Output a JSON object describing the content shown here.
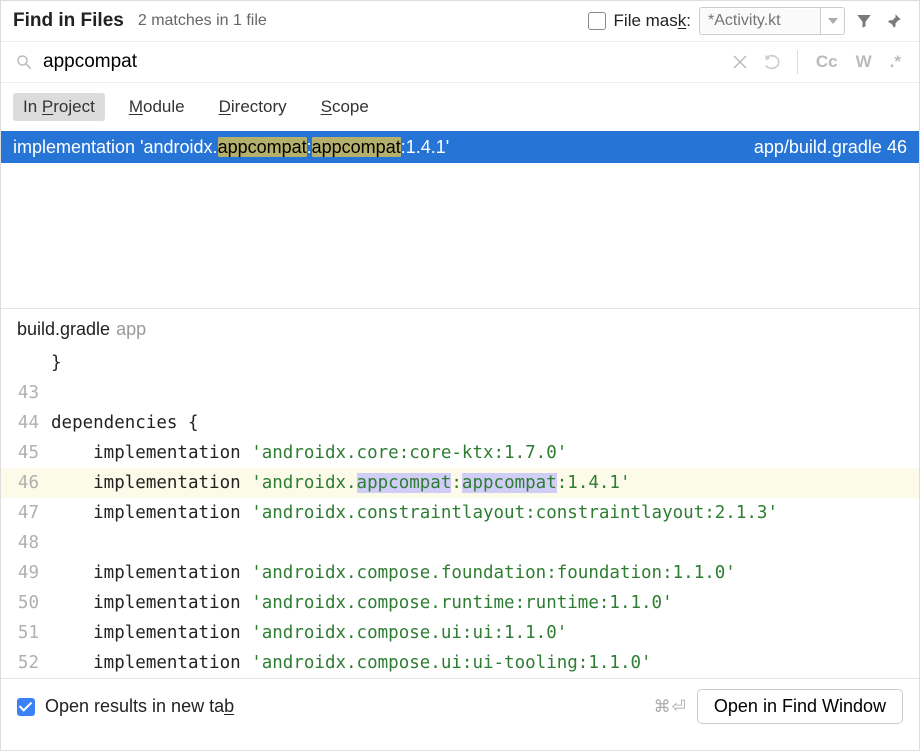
{
  "header": {
    "title": "Find in Files",
    "subtitle": "2 matches in 1 file",
    "file_mask_label": "File mask:",
    "file_mask_underline": "k",
    "file_mask_placeholder": "*Activity.kt"
  },
  "search": {
    "query": "appcompat",
    "match_case": "Cc",
    "words": "W",
    "regex": ".*"
  },
  "scopes": {
    "items": [
      {
        "pre": "In ",
        "key": "P",
        "rest": "roject",
        "active": true
      },
      {
        "pre": "",
        "key": "M",
        "rest": "odule",
        "active": false
      },
      {
        "pre": "",
        "key": "D",
        "rest": "irectory",
        "active": false
      },
      {
        "pre": "",
        "key": "S",
        "rest": "cope",
        "active": false
      }
    ]
  },
  "result": {
    "prefix": "implementation 'androidx.",
    "m1": "appcompat",
    "sep": ":",
    "m2": "appcompat",
    "suffix": ":1.4.1'",
    "path": "app/build.gradle",
    "line": "46"
  },
  "preview": {
    "file": "build.gradle",
    "module": "app"
  },
  "editor": {
    "lines": [
      {
        "n": "",
        "kw": "}",
        "str": "",
        "current": false
      },
      {
        "n": "43",
        "kw": "",
        "str": "",
        "current": false
      },
      {
        "n": "44",
        "kw": "dependencies {",
        "str": "",
        "current": false,
        "indent": ""
      },
      {
        "n": "45",
        "kw": "implementation ",
        "str": "'androidx.core:core-ktx:1.7.0'",
        "current": false,
        "indent": "    "
      },
      {
        "n": "46",
        "kw": "implementation ",
        "strpre": "'androidx.",
        "m1": "appcompat",
        "sep": ":",
        "m2": "appcompat",
        "strpost": ":1.4.1'",
        "current": true,
        "indent": "    "
      },
      {
        "n": "47",
        "kw": "implementation ",
        "str": "'androidx.constraintlayout:constraintlayout:2.1.3'",
        "current": false,
        "indent": "    "
      },
      {
        "n": "48",
        "kw": "",
        "str": "",
        "current": false
      },
      {
        "n": "49",
        "kw": "implementation ",
        "str": "'androidx.compose.foundation:foundation:1.1.0'",
        "current": false,
        "indent": "    "
      },
      {
        "n": "50",
        "kw": "implementation ",
        "str": "'androidx.compose.runtime:runtime:1.1.0'",
        "current": false,
        "indent": "    "
      },
      {
        "n": "51",
        "kw": "implementation ",
        "str": "'androidx.compose.ui:ui:1.1.0'",
        "current": false,
        "indent": "    "
      },
      {
        "n": "52",
        "kw": "implementation ",
        "str": "'androidx.compose.ui:ui-tooling:1.1.0'",
        "current": false,
        "indent": "    "
      }
    ]
  },
  "footer": {
    "checkbox_label": "Open results in new tab",
    "checkbox_key": "b",
    "shortcut": "⌘⏎",
    "button": "Open in Find Window"
  }
}
